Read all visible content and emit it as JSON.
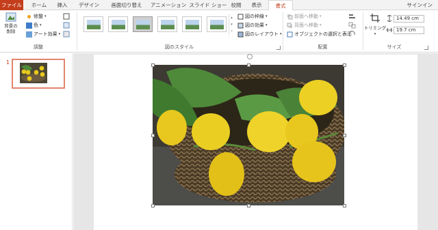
{
  "tabs": {
    "file": "ファイル",
    "home": "ホーム",
    "insert": "挿入",
    "design": "デザイン",
    "transitions": "画面切り替え",
    "animations": "アニメーション",
    "slideshow": "スライド ショー",
    "review": "校閲",
    "view": "表示",
    "format": "書式",
    "signin": "サインイン"
  },
  "ribbon": {
    "adjust": {
      "remove_bg": "背景の削除",
      "corrections": "修整",
      "color": "色",
      "artistic": "アート効果",
      "label": "調整"
    },
    "styles": {
      "border": "図の枠線",
      "effects": "図の効果",
      "layout": "図のレイアウト",
      "label": "図のスタイル"
    },
    "arrange": {
      "bring_forward": "前面へ移動",
      "send_backward": "背面へ移動",
      "selection_pane": "オブジェクトの選択と表示",
      "label": "配置"
    },
    "size": {
      "crop": "トリミング",
      "height": "14.49 cm",
      "width": "19.7 cm",
      "label": "サイズ"
    }
  },
  "slides": {
    "number": "1"
  },
  "colors": {
    "accent": "#c43e1c",
    "tulip": "#e8c81e",
    "leaf": "#4f8a3a"
  }
}
